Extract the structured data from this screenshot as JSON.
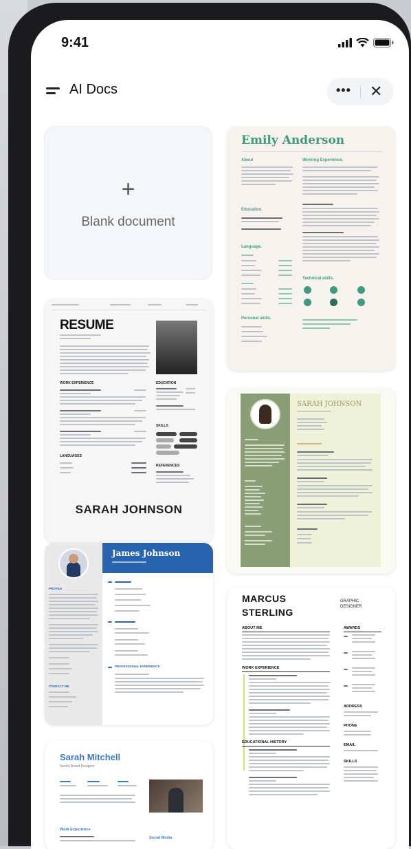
{
  "status_bar": {
    "time": "9:41"
  },
  "header": {
    "title": "AI Docs",
    "more_label": "•••",
    "close_label": "✕"
  },
  "templates": {
    "blank": {
      "plus": "+",
      "label": "Blank document"
    },
    "emily": {
      "name": "Emily Anderson",
      "about": "About",
      "experience": "Working Experience.",
      "education": "Education.",
      "language": "Language.",
      "technical": "Technical skills.",
      "personal": "Personal skills."
    },
    "resume": {
      "title": "RESUME",
      "work": "WORK EXPERIENCE",
      "education": "EDUCATION",
      "skills": "SKILLS",
      "languages": "LANGUAGES",
      "references": "REFERENCES",
      "name": "SARAH JOHNSON"
    },
    "sarah_johnson": {
      "name": "SARAH JOHNSON"
    },
    "james": {
      "name": "James Johnson",
      "profile": "PROFILE",
      "contact": "CONTACT ME",
      "experience": "PROFESSIONAL EXPERIENCE"
    },
    "marcus": {
      "name": "MARCUS STERLING",
      "role": "GRAPHIC DESIGNER",
      "about": "ABOUT ME",
      "work": "WORK EXPERIENCE",
      "education": "EDUCATIONAL HISTORY",
      "awards": "AWARDS",
      "address": "ADDRESS",
      "phone": "PHONE",
      "email": "EMAIL",
      "skills": "SKILLS"
    },
    "sarah_mitchell": {
      "name": "Sarah Mitchell",
      "subtitle": "Senior Brand Designer",
      "work": "Work Experience",
      "social": "Social Media"
    }
  }
}
